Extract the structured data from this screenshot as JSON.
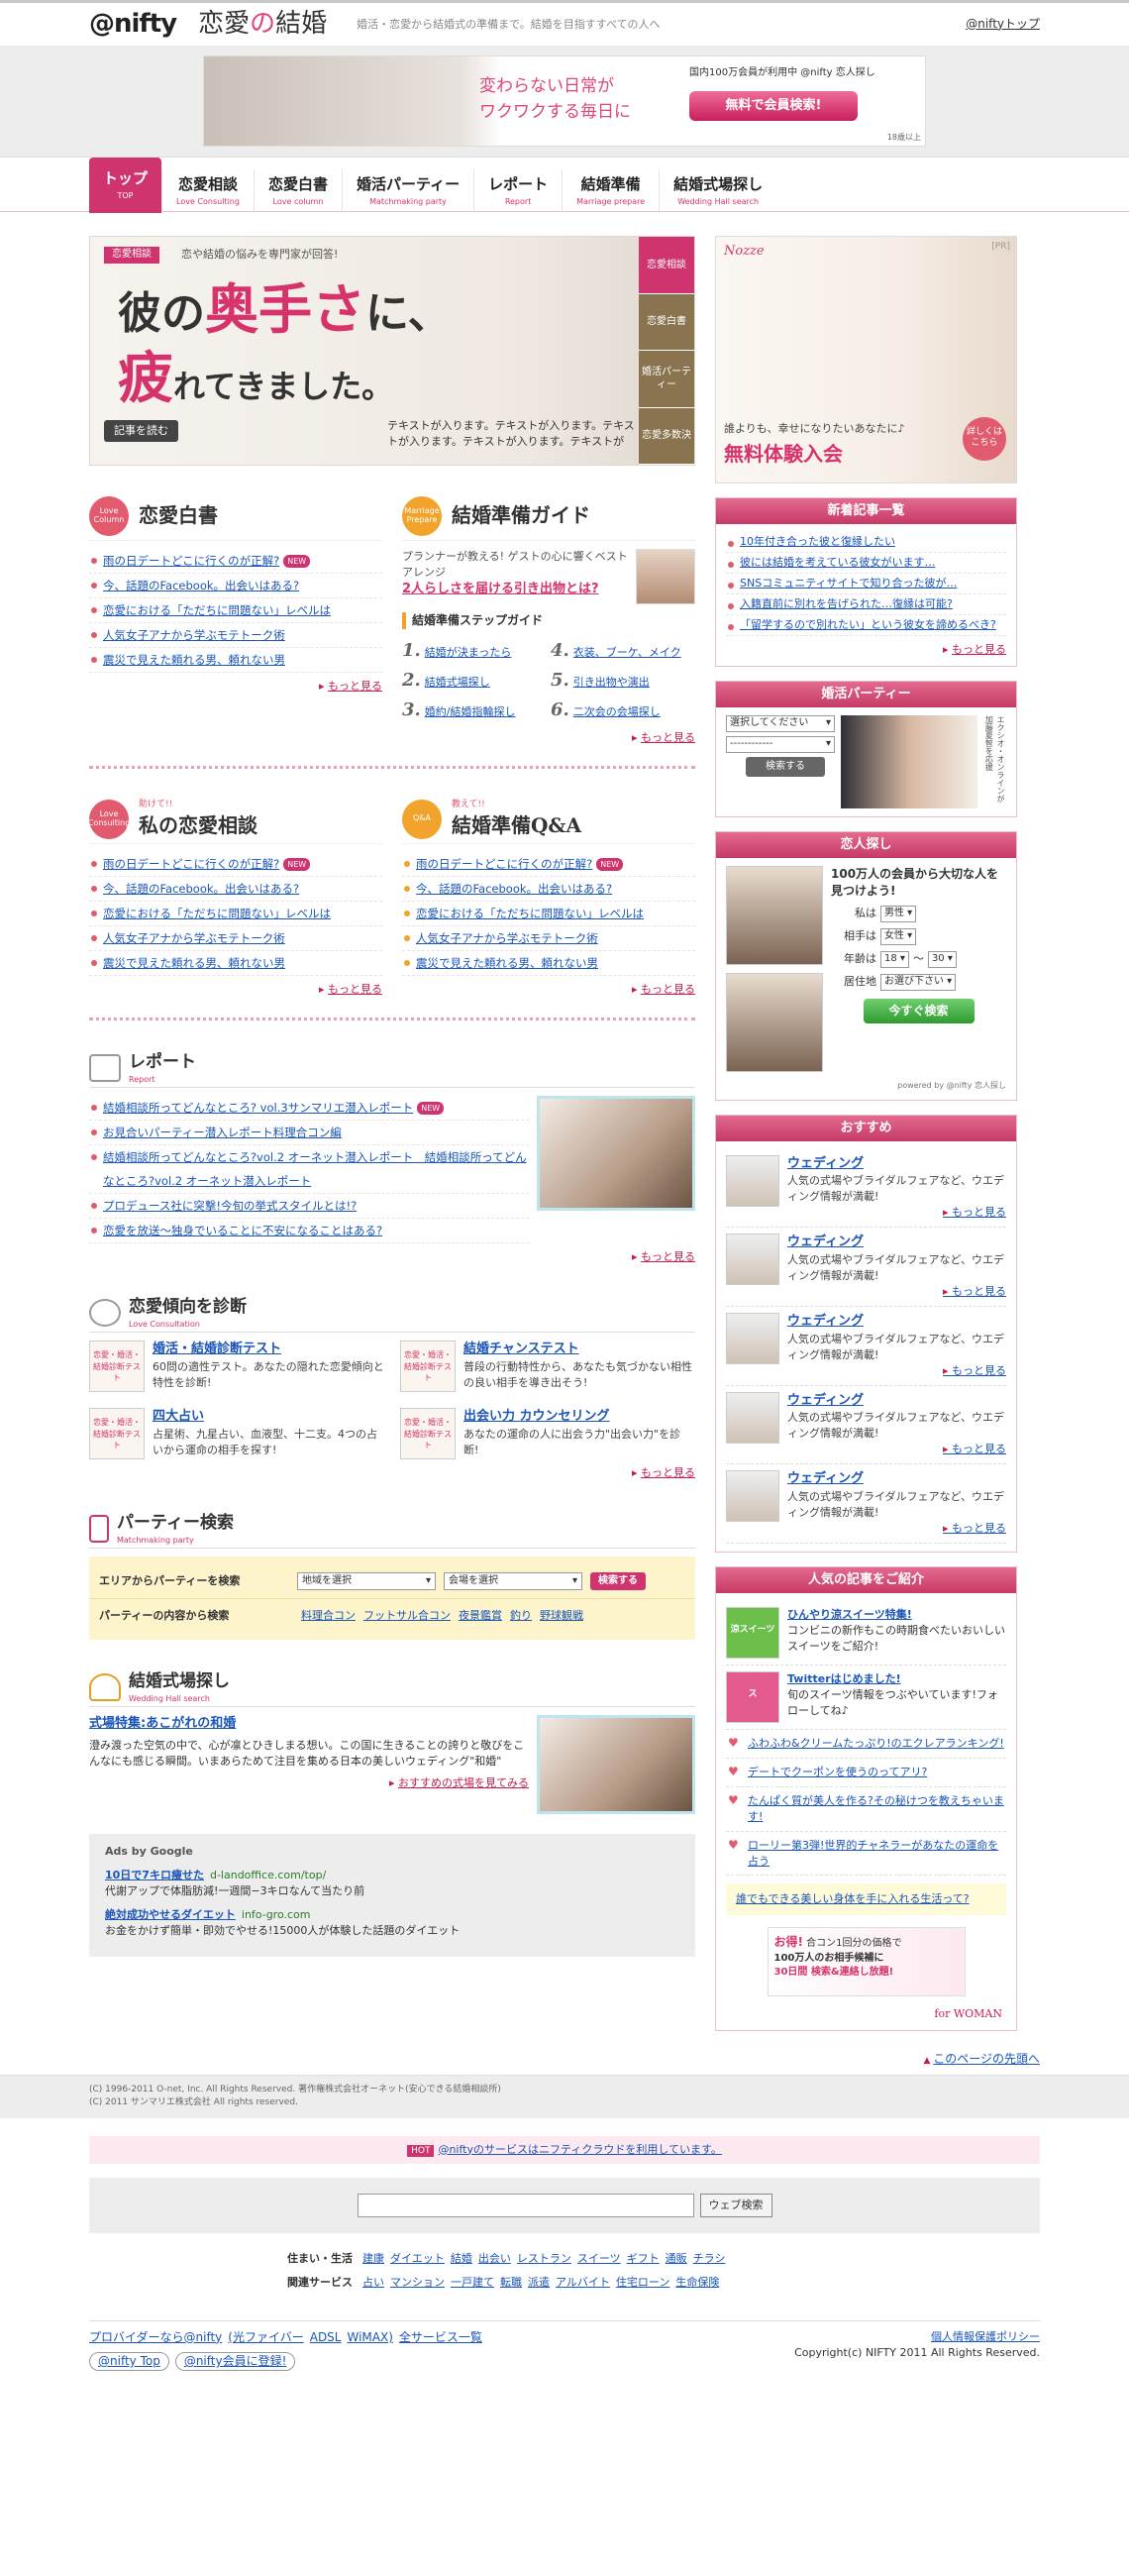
{
  "header": {
    "logo": "@nifty",
    "site_a": "恋愛",
    "site_heart": "の",
    "site_b": "結婚",
    "tagline": "婚活・恋愛から結婚式の準備まで。結婚を目指すすべての人へ",
    "top_link": "@niftyトップ"
  },
  "banner": {
    "copy1": "変わらない日常が",
    "copy2": "ワクワクする毎日に",
    "small": "国内100万会員が利用中 @nifty 恋人探し",
    "button": "無料で会員検索!",
    "note": "18歳以上"
  },
  "nav": [
    {
      "jp": "トップ",
      "en": "TOP"
    },
    {
      "jp": "恋愛相談",
      "en": "Love Consulting"
    },
    {
      "jp": "恋愛白書",
      "en": "Love column"
    },
    {
      "jp": "婚活パーティー",
      "en": "Matchmaking party"
    },
    {
      "jp": "レポート",
      "en": "Report"
    },
    {
      "jp": "結婚準備",
      "en": "Marriage prepare"
    },
    {
      "jp": "結婚式場探し",
      "en": "Wedding Hall search"
    }
  ],
  "hero": {
    "tag": "恋愛相談",
    "sub": "恋や結婚の悩みを専門家が回答!",
    "title_a": "彼の",
    "title_b": "奥手さ",
    "title_c": "に、",
    "title_d": "疲",
    "title_e": "れてきました。",
    "read": "記事を読む",
    "text": "テキストが入ります。テキストが入ります。テキストが入ります。テキストが入ります。テキストが",
    "side": [
      "恋愛相談",
      "恋愛白書",
      "婚活パーティー",
      "恋愛多数決"
    ]
  },
  "hakusho": {
    "badge": "Love Column",
    "title": "恋愛白書",
    "items": [
      "雨の日デートどこに行くのが正解?",
      "今、話題のFacebook。出会いはある?",
      "恋愛における「ただちに問題ない」レベルは",
      "人気女子アナから学ぶモテトーク術",
      "震災で見えた頼れる男、頼れない男"
    ],
    "more": "もっと見る",
    "new": "NEW"
  },
  "guide": {
    "badge": "Marriage Prepare",
    "title": "結婚準備ガイド",
    "sub": "プランナーが教える! ゲストの心に響くベストアレンジ",
    "big": "2人らしさを届ける引き出物とは?",
    "step_title": "結婚準備ステップガイド",
    "steps": [
      {
        "n": "1.",
        "t": "結婚が決まったら"
      },
      {
        "n": "4.",
        "t": "衣装、ブーケ、メイク"
      },
      {
        "n": "2.",
        "t": "結婚式場探し"
      },
      {
        "n": "5.",
        "t": "引き出物や演出"
      },
      {
        "n": "3.",
        "t": "婚約/結婚指輪探し"
      },
      {
        "n": "6.",
        "t": "二次会の会場探し"
      }
    ],
    "more": "もっと見る"
  },
  "soudan": {
    "badge": "Love Consulting",
    "pre": "助けて!!",
    "title": "私の恋愛相談",
    "items": [
      "雨の日デートどこに行くのが正解?",
      "今、話題のFacebook。出会いはある?",
      "恋愛における「ただちに問題ない」レベルは",
      "人気女子アナから学ぶモテトーク術",
      "震災で見えた頼れる男、頼れない男"
    ],
    "more": "もっと見る"
  },
  "qa": {
    "badge": "Q&A",
    "pre": "教えて!!",
    "title": "結婚準備Q&A",
    "items": [
      "雨の日デートどこに行くのが正解?",
      "今、話題のFacebook。出会いはある?",
      "恋愛における「ただちに問題ない」レベルは",
      "人気女子アナから学ぶモテトーク術",
      "震災で見えた頼れる男、頼れない男"
    ],
    "more": "もっと見る"
  },
  "report": {
    "title": "レポート",
    "en": "Report",
    "items": [
      "結婚相談所ってどんなところ? vol.3サンマリエ潜入レポート",
      "お見合いパーティー潜入レポート料理合コン編",
      "結婚相談所ってどんなところ?vol.2 オーネット潜入レポート　結婚相談所ってどんなところ?vol.2 オーネット潜入レポート",
      "プロデュース社に突撃!今旬の挙式スタイルとは!?",
      "恋愛を放送〜独身でいることに不安になることはある?"
    ],
    "more": "もっと見る"
  },
  "diag": {
    "title": "恋愛傾向を診断",
    "en": "Love Consultation",
    "items": [
      {
        "t": "婚活・結婚診断テスト",
        "d": "60問の適性テスト。あなたの隠れた恋愛傾向と特性を診断!"
      },
      {
        "t": "結婚チャンステスト",
        "d": "普段の行動特性から、あなたも気づかない相性の良い相手を導き出そう!"
      },
      {
        "t": "四大占い",
        "d": "占星術、九星占い、血液型、十二支。4つの占いから運命の相手を探す!"
      },
      {
        "t": "出会い力 カウンセリング",
        "d": "あなたの運命の人に出会う力\"出会い力\"を診断!"
      }
    ],
    "img": "恋愛・婚活・結婚診断テスト",
    "more": "もっと見る"
  },
  "party": {
    "title": "パーティー検索",
    "en": "Matchmaking party",
    "area": "エリアからパーティーを検索",
    "area_sel": "地域を選択",
    "venue_sel": "会場を選択",
    "btn": "検索する",
    "content": "パーティーの内容から検索",
    "tags": [
      "料理合コン",
      "フットサル合コン",
      "夜景鑑賞",
      "釣り",
      "野球観戦"
    ]
  },
  "hall": {
    "title": "結婚式場探し",
    "en": "Wedding Hall search",
    "link": "式場特集:あこがれの和婚",
    "text": "澄み渡った空気の中で、心が凛とひきしまる想い。この国に生きることの誇りと敬びをこんなにも感じる瞬間。いまあらためて注目を集める日本の美しいウェディング\"和婚\"",
    "more": "おすすめの式場を見てみる"
  },
  "ads": {
    "title": "Ads by Google",
    "items": [
      {
        "t": "10日で7キロ痩せた",
        "u": "d-landoffice.com/top/",
        "d": "代謝アップで体脂肪減!一週間−3キロなんて当たり前"
      },
      {
        "t": "絶対成功やせるダイエット",
        "u": "info-gro.com",
        "d": "お金をかけず簡単・即効でやせる!15000人が体験した話題のダイエット"
      }
    ]
  },
  "right_ad": {
    "tag": "Nozze",
    "pr": "[PR]",
    "c1": "誰よりも、幸せになりたいあなたに♪",
    "c2": "無料体験入会",
    "c3": "詳しくはこちら"
  },
  "newest": {
    "title": "新着記事一覧",
    "items": [
      "10年付き合った彼と復縁したい",
      "彼には結婚を考えている彼女がいます…",
      "SNSコミュニティサイトで知り合った彼が…",
      "入籍直前に別れを告げられた…復縁は可能?",
      "「留学するので別れたい」という彼女を諦めるべき?"
    ],
    "more": "もっと見る"
  },
  "party_r": {
    "title": "婚活パーティー",
    "sel1": "選択してください",
    "sel2": "------------",
    "btn": "検索する",
    "side": "エクシオ・オンラインが加藤夏智を応援"
  },
  "lover": {
    "title": "恋人探し",
    "headline": "100万人の会員から大切な人を見つけよう!",
    "me": "私は",
    "me_v": "男性",
    "partner": "相手は",
    "partner_v": "女性",
    "age": "年齢は",
    "age_a": "18",
    "age_sep": "〜",
    "age_b": "30",
    "area": "居住地",
    "area_v": "お選び下さい",
    "btn": "今すぐ検索",
    "powered": "powered by @nifty 恋人探し"
  },
  "recommend": {
    "title": "おすすめ",
    "items": [
      {
        "t": "ウェディング",
        "d": "人気の式場やブライダルフェアなど、ウエディング情報が満載!"
      },
      {
        "t": "ウェディング",
        "d": "人気の式場やブライダルフェアなど、ウエディング情報が満載!"
      },
      {
        "t": "ウェディング",
        "d": "人気の式場やブライダルフェアなど、ウエディング情報が満載!"
      },
      {
        "t": "ウェディング",
        "d": "人気の式場やブライダルフェアなど、ウエディング情報が満載!"
      },
      {
        "t": "ウェディング",
        "d": "人気の式場やブライダルフェアなど、ウエディング情報が満載!"
      }
    ],
    "more": "もっと見る"
  },
  "popular": {
    "title": "人気の記事をご紹介",
    "items": [
      {
        "img": "涼スイーツ",
        "t": "ひんやり涼スイーツ特集!",
        "d": "コンビニの新作もこの時期食べたいおいしいスイーツをご紹介!"
      },
      {
        "img": "ス",
        "t": "Twitterはじめました!",
        "d": "旬のスイーツ情報をつぶやいています!フォローしてね♪"
      }
    ],
    "links": [
      "ふわふわ&クリームたっぷり!のエクレアランキング!",
      "デートでクーポンを使うのってアリ?",
      "たんぱく質が美人を作る?その秘けつを教えちゃいます!",
      "ローリー第3弾!世界的チャネラーがあなたの運命を占う"
    ],
    "note": "誰でもできる美しい身体を手に入れる生活って?",
    "ban_a": "お得!",
    "ban_b": "合コン1回分の価格で",
    "ban_c": "100万人のお相手候補に",
    "ban_d": "30日間 検索&連絡し放題!",
    "for": "for WOMAN"
  },
  "footer": {
    "pagetop": "このページの先頭へ",
    "copy1": "(C) 1996-2011 O-net, Inc. All Rights Reserved. 著作権株式会社オーネット(安心できる結婚相談所)",
    "copy2": "(C) 2011 サンマリエ株式会社 All rights reserved.",
    "svc_ic": "HOT",
    "svc": "@niftyのサービスはニフティクラウドを利用しています。",
    "search_btn": "ウェブ検索",
    "row1_label": "住まい・生活",
    "row1": [
      "建康",
      "ダイエット",
      "結婚",
      "出会い",
      "レストラン",
      "スイーツ",
      "ギフト",
      "通販",
      "チラシ"
    ],
    "row2_label": "関連サービス",
    "row2": [
      "占い",
      "マンション",
      "一戸建て",
      "転職",
      "派遣",
      "アルバイト",
      "住宅ローン",
      "生命保険"
    ],
    "prov": [
      "プロバイダーなら@nifty",
      "(光ファイバー",
      "ADSL",
      "WiMAX)",
      "全サービス一覧"
    ],
    "pill1": "@nifty Top",
    "pill2": "@nifty会員に登録!",
    "privacy": "個人情報保護ポリシー",
    "copyright": "Copyright(c) NIFTY 2011 All Rights Reserved."
  }
}
